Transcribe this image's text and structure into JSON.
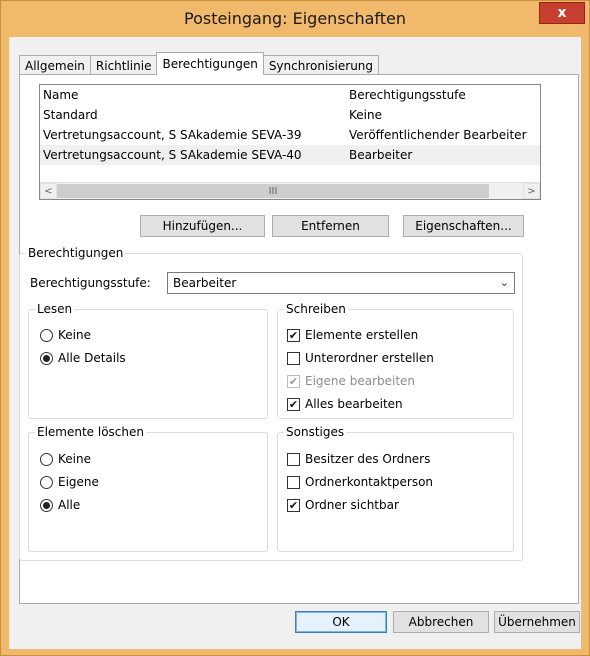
{
  "window": {
    "title": "Posteingang: Eigenschaften",
    "close_glyph": "x"
  },
  "tabs": [
    {
      "label": "Allgemein",
      "active": false
    },
    {
      "label": "Richtlinie",
      "active": false
    },
    {
      "label": "Berechtigungen",
      "active": true
    },
    {
      "label": "Synchronisierung",
      "active": false
    }
  ],
  "permissions_list": {
    "columns": [
      "Name",
      "Berechtigungsstufe"
    ],
    "rows": [
      {
        "name": "Standard",
        "level": "Keine",
        "selected": false
      },
      {
        "name": "Vertretungsaccount, S SAkademie SEVA-39",
        "level": "Veröffentlichender Bearbeiter",
        "selected": false
      },
      {
        "name": "Vertretungsaccount, S SAkademie SEVA-40",
        "level": "Bearbeiter",
        "selected": true
      }
    ],
    "scroll_left": "<",
    "scroll_right": ">",
    "scroll_thumb_grip": "III"
  },
  "list_buttons": {
    "add": "Hinzufügen...",
    "remove": "Entfernen",
    "properties": "Eigenschaften..."
  },
  "permissions_group": {
    "label": "Berechtigungen",
    "level_label": "Berechtigungsstufe:",
    "level_value": "Bearbeiter",
    "dropdown_glyph": "⌄"
  },
  "read_group": {
    "label": "Lesen",
    "options": [
      {
        "label": "Keine",
        "selected": false
      },
      {
        "label": "Alle Details",
        "selected": true
      }
    ]
  },
  "write_group": {
    "label": "Schreiben",
    "options": [
      {
        "label": "Elemente erstellen",
        "checked": true,
        "disabled": false
      },
      {
        "label": "Unterordner erstellen",
        "checked": false,
        "disabled": false
      },
      {
        "label": "Eigene bearbeiten",
        "checked": true,
        "disabled": true
      },
      {
        "label": "Alles bearbeiten",
        "checked": true,
        "disabled": false
      }
    ]
  },
  "delete_group": {
    "label": "Elemente löschen",
    "options": [
      {
        "label": "Keine",
        "selected": false
      },
      {
        "label": "Eigene",
        "selected": false
      },
      {
        "label": "Alle",
        "selected": true
      }
    ]
  },
  "other_group": {
    "label": "Sonstiges",
    "options": [
      {
        "label": "Besitzer des Ordners",
        "checked": false
      },
      {
        "label": "Ordnerkontaktperson",
        "checked": false
      },
      {
        "label": "Ordner sichtbar",
        "checked": true
      }
    ]
  },
  "dialog_buttons": {
    "ok": "OK",
    "cancel": "Abbrechen",
    "apply": "Übernehmen"
  },
  "check_glyph": "✔"
}
